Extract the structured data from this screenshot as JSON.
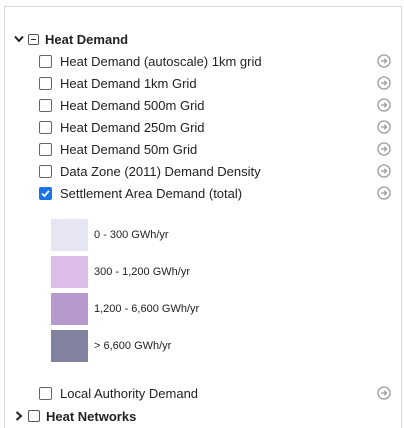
{
  "heat_demand_group": {
    "label": "Heat Demand",
    "layers": [
      {
        "label": "Heat Demand (autoscale) 1km grid",
        "checked": false
      },
      {
        "label": "Heat Demand 1km Grid",
        "checked": false
      },
      {
        "label": "Heat Demand 500m Grid",
        "checked": false
      },
      {
        "label": "Heat Demand 250m Grid",
        "checked": false
      },
      {
        "label": "Heat Demand 50m Grid",
        "checked": false
      },
      {
        "label": "Data Zone (2011) Demand Density",
        "checked": false
      },
      {
        "label": "Settlement Area Demand (total)",
        "checked": true
      }
    ],
    "legend": [
      {
        "label": "0 - 300 GWh/yr",
        "color": "#e6e6f2"
      },
      {
        "label": "300 - 1,200 GWh/yr",
        "color": "#dbbde8"
      },
      {
        "label": "1,200 - 6,600 GWh/yr",
        "color": "#b599cf"
      },
      {
        "label": "> 6,600 GWh/yr",
        "color": "#80829f"
      }
    ],
    "after_legend_layer": {
      "label": "Local Authority Demand",
      "checked": false
    }
  },
  "heat_networks_group": {
    "label": "Heat Networks"
  }
}
